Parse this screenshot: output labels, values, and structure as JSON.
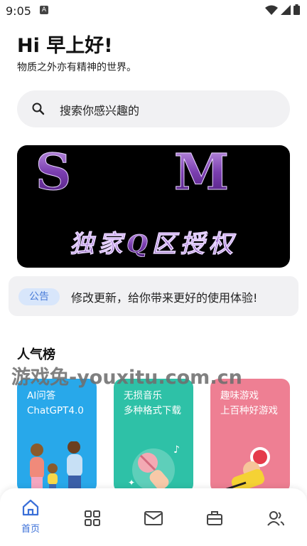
{
  "status_bar": {
    "time": "9:05",
    "badge": "A"
  },
  "header": {
    "greeting": "Hi 早上好!",
    "subtitle": "物质之外亦有精神的世界。"
  },
  "search": {
    "placeholder": "搜索你感兴趣的"
  },
  "banner": {
    "line1": "S M",
    "line2": "独家Q区授权"
  },
  "notice": {
    "tag": "公告",
    "text": "修改更新，给你带来更好的使用体验!"
  },
  "popular": {
    "title": "人气榜",
    "cards": [
      {
        "title": "AI问答\nChatGPT4.0",
        "color": "#28a8ea"
      },
      {
        "title": "无损音乐\n多种格式下载",
        "color": "#2ec1a7"
      },
      {
        "title": "趣味游戏\n上百种好游戏",
        "color": "#ee7f93"
      }
    ]
  },
  "watermark": "游戏兔-youxitu.com.cn",
  "bottom_nav": {
    "items": [
      {
        "icon": "home-icon",
        "label": "首页",
        "active": true
      },
      {
        "icon": "grid-icon",
        "label": ""
      },
      {
        "icon": "inbox-icon",
        "label": ""
      },
      {
        "icon": "toolbox-icon",
        "label": ""
      },
      {
        "icon": "users-icon",
        "label": ""
      }
    ],
    "accent": "#3a6fd8"
  }
}
